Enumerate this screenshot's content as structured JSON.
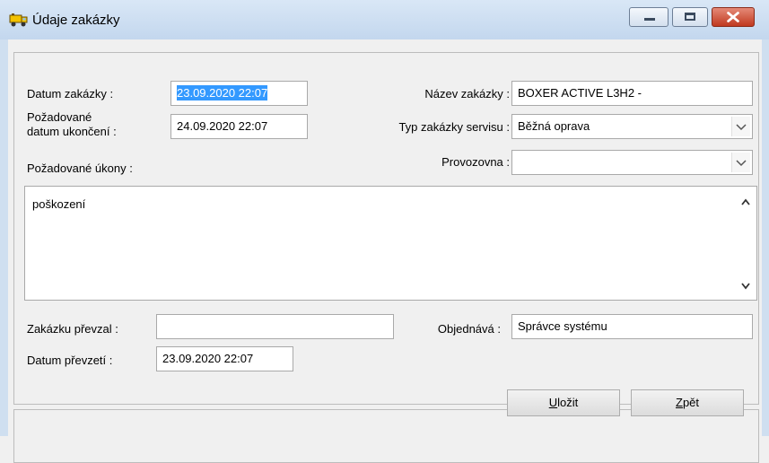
{
  "window": {
    "title": "Údaje zakázky",
    "icons": {
      "app": "truck-icon",
      "minimize": "minimize-icon",
      "maximize": "maximize-icon",
      "close": "close-icon"
    }
  },
  "form": {
    "datum_zakazky": {
      "label": "Datum zakázky :",
      "value": "23.09.2020 22:07"
    },
    "pozadovane_datum": {
      "label_line1": "Požadované",
      "label_line2": "datum ukončení :",
      "value": "24.09.2020 22:07"
    },
    "nazev_zakazky": {
      "label": "Název zakázky :",
      "value": "BOXER ACTIVE L3H2 -"
    },
    "typ_zakazky": {
      "label": "Typ zakázky servisu :",
      "value": "Běžná oprava"
    },
    "provozovna": {
      "label": "Provozovna :",
      "value": ""
    },
    "pozadovane_ukony": {
      "label": "Požadované úkony :",
      "value": "poškození"
    },
    "zakazku_prevzal": {
      "label": "Zakázku převzal :",
      "value": ""
    },
    "objednava": {
      "label": "Objednává :",
      "value": "Správce systému"
    },
    "datum_prevzeti": {
      "label": "Datum převzetí :",
      "value": "23.09.2020 22:07"
    }
  },
  "buttons": {
    "save": {
      "mnemonic": "U",
      "rest": "ložit"
    },
    "back": {
      "mnemonic": "Z",
      "rest": "pět"
    }
  }
}
